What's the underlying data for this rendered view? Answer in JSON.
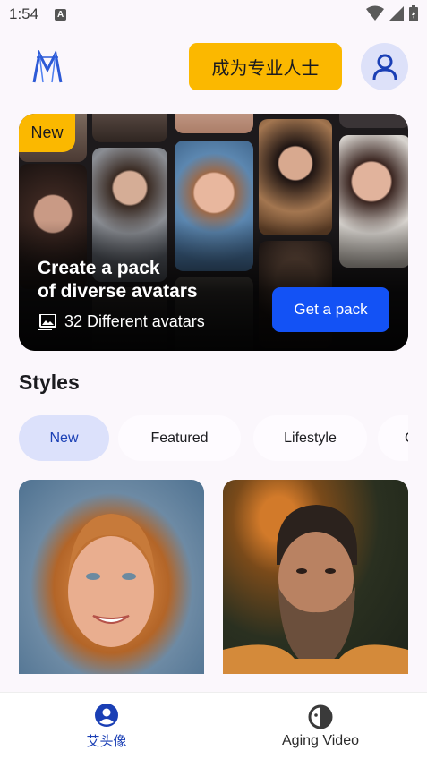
{
  "status_bar": {
    "time": "1:54",
    "notification_icon": "a-icon",
    "icons": [
      "wifi-icon",
      "signal-icon",
      "battery-icon"
    ]
  },
  "header": {
    "logo": "m-logo-icon",
    "pro_button_label": "成为专业人士",
    "profile_icon": "person-icon"
  },
  "banner": {
    "badge": "New",
    "title_line1": "Create a pack",
    "title_line2": "of diverse avatars",
    "subtitle": "32 Different avatars",
    "subtitle_icon": "image-icon",
    "cta_label": "Get a pack"
  },
  "styles": {
    "title": "Styles",
    "chips": [
      {
        "label": "New",
        "active": true
      },
      {
        "label": "Featured",
        "active": false
      },
      {
        "label": "Lifestyle",
        "active": false
      },
      {
        "label": "C",
        "active": false
      }
    ]
  },
  "bottom_nav": {
    "items": [
      {
        "label": "艾头像",
        "icon": "account-circle-icon",
        "active": true
      },
      {
        "label": "Aging Video",
        "icon": "aging-face-icon",
        "active": false
      }
    ]
  },
  "colors": {
    "accent_yellow": "#fbb800",
    "accent_blue": "#1352f5",
    "active_chip_bg": "#dce1fb",
    "nav_active": "#1a3fb5"
  }
}
